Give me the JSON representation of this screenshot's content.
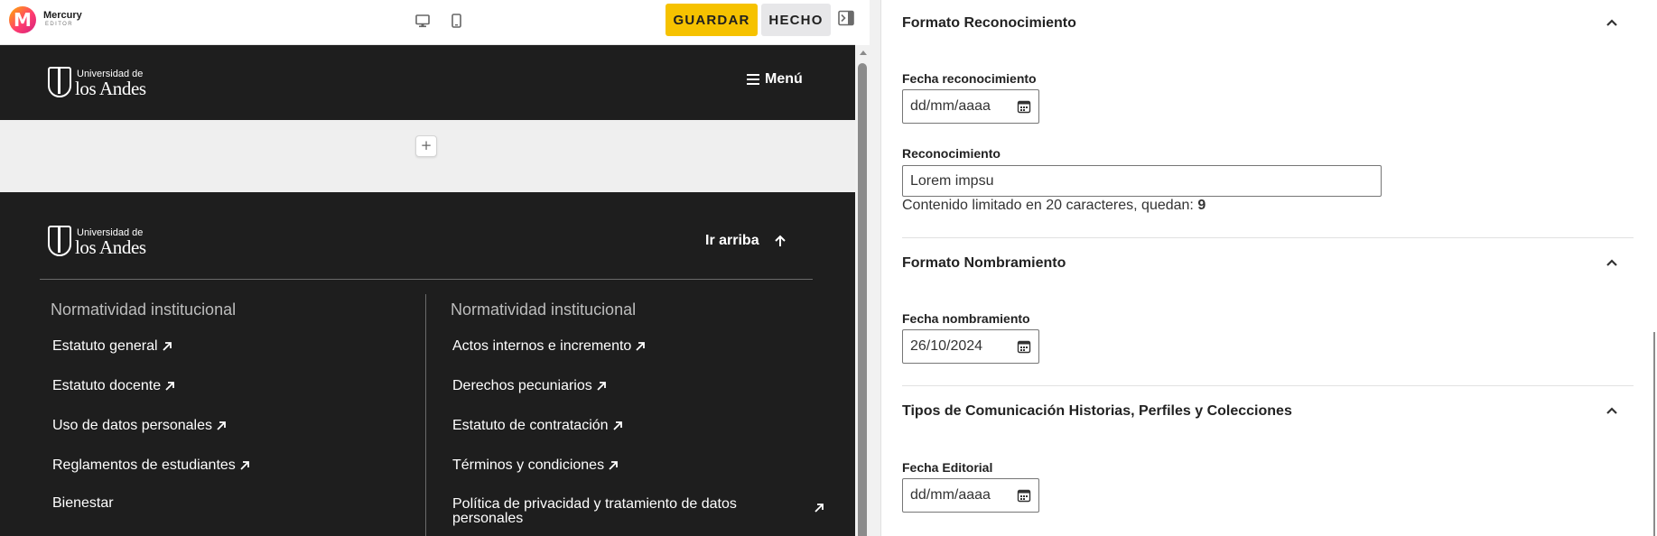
{
  "toolbar": {
    "logo_name": "Mercury",
    "logo_sub": "EDITOR",
    "desktop_icon": "desktop-icon",
    "mobile_icon": "mobile-icon",
    "save_label": "GUARDAR",
    "done_label": "HECHO",
    "panel_toggle_icon": "panel-collapse-icon"
  },
  "preview": {
    "brand_line1": "Universidad de",
    "brand_line2": "los Andes",
    "menu_label": "Menú",
    "add_symbol": "+",
    "footer": {
      "back_to_top": "Ir arriba",
      "col1_heading": "Normatividad institucional",
      "col1_links": [
        "Estatuto general",
        "Estatuto docente",
        "Uso de datos personales",
        "Reglamentos de estudiantes",
        "Bienestar"
      ],
      "col2_heading": "Normatividad institucional",
      "col2_links": [
        "Actos internos e incremento",
        "Derechos pecuniarios",
        "Estatuto de contratación",
        "Términos y condiciones",
        "Política de privacidad y tratamiento de datos personales"
      ]
    }
  },
  "panel": {
    "sections": [
      {
        "title": "Formato Reconocimiento",
        "date_label": "Fecha reconocimiento",
        "date_value": "dd/mm/aaaa",
        "text_label": "Reconocimiento",
        "text_value": "Lorem impsu",
        "help_text": "Contenido limitado en 20 caracteres, quedan:",
        "remaining": "9"
      },
      {
        "title": "Formato Nombramiento",
        "date_label": "Fecha nombramiento",
        "date_value": "26/10/2024"
      },
      {
        "title": "Tipos de Comunicación Historias, Perfiles y Colecciones",
        "date_label": "Fecha Editorial",
        "date_value": "dd/mm/aaaa"
      }
    ]
  },
  "colors": {
    "accent": "#f6c200",
    "site_dark": "#1e1e1e",
    "add_zone": "#efefef"
  }
}
